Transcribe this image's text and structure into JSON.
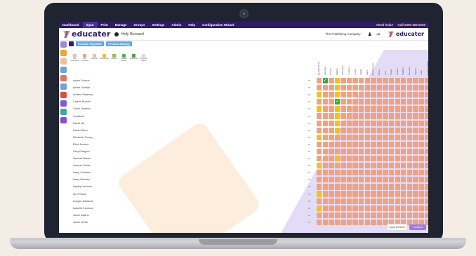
{
  "nav": {
    "items": [
      "Dashboard",
      "Input",
      "Print",
      "Manage",
      "Groups",
      "Settings",
      "Admin",
      "Help",
      "Configuration Wizard"
    ],
    "active_index": 1,
    "need_help": "Need help?",
    "phone": "Call 0300 303 0220"
  },
  "header": {
    "logo_text": "educater",
    "user_name": "Holly Ricouard",
    "org_name": "The Publishing Company",
    "logo2_text": "educater"
  },
  "toolbar": {
    "btn1": "Personal Targets/Ex",
    "btn2": "Personal Strategy"
  },
  "legend": [
    {
      "label": "Not Assessed",
      "color": "#c9c9c9"
    },
    {
      "label": "Not Covered",
      "color": "#f0a27f"
    },
    {
      "label": "Attempt",
      "color": "#f5c089"
    },
    {
      "label": "Developing",
      "color": "#f1c21b"
    },
    {
      "label": "Secure",
      "color": "#8cc63f"
    },
    {
      "label": "Greater Depth",
      "color": "#52b05a"
    },
    {
      "label": "Mastered",
      "color": "#3da640"
    },
    {
      "label": "Remove Grade",
      "color": "#dddddd"
    }
  ],
  "students": [
    "Aaron Francis",
    "Alexie Smithie",
    "Andrea Sharman",
    "Callum Burnell",
    "Chloe Jackson",
    "Coralblue",
    "David Hill",
    "Daniel Steer",
    "Elizabeth Finney",
    "Elliot Jenkins",
    "Gary Rodgers",
    "Hannah Bristol",
    "Hannah Carter",
    "Harry Cookson",
    "Harry Machen",
    "Hayley Johnson",
    "Ian Preston",
    "Imogen Edwards",
    "Isabella Cookson",
    "Jamie Adkins",
    "Jamie Webb"
  ],
  "scores": [
    "66",
    "66",
    "66",
    "66",
    "66",
    "66",
    "66",
    "66",
    "66",
    "66",
    "66",
    "66",
    "66",
    "66",
    "66",
    "66",
    "66",
    "66",
    "66",
    "66",
    "66"
  ],
  "columns": [
    "Reading Words",
    "Counting",
    "Number",
    "Addition",
    "Subtraction",
    "Fractions",
    "Length",
    "Weight",
    "Mass",
    "Measurement",
    "Money",
    "Time",
    "Shape",
    "Position",
    "Statistics",
    "Geometry",
    "Algebra",
    "Ratio",
    "Problem Solving"
  ],
  "grid": [
    [
      "o",
      "g",
      "o",
      "y",
      "o",
      "o",
      "o",
      "o",
      "o",
      "o",
      "o",
      "o",
      "o",
      "o",
      "o",
      "o",
      "o",
      "o",
      "o"
    ],
    [
      "o",
      "o",
      "o",
      "y",
      "o",
      "o",
      "o",
      "o",
      "o",
      "o",
      "o",
      "o",
      "o",
      "o",
      "o",
      "o",
      "o",
      "o",
      "o"
    ],
    [
      "y",
      "o",
      "o",
      "y",
      "o",
      "o",
      "o",
      "o",
      "o",
      "o",
      "o",
      "o",
      "o",
      "o",
      "o",
      "o",
      "o",
      "o",
      "o"
    ],
    [
      "o",
      "o",
      "o",
      "g",
      "o",
      "o",
      "o",
      "o",
      "o",
      "o",
      "o",
      "o",
      "o",
      "o",
      "o",
      "o",
      "o",
      "o",
      "o"
    ],
    [
      "y",
      "o",
      "o",
      "y",
      "o",
      "o",
      "o",
      "o",
      "o",
      "o",
      "o",
      "o",
      "o",
      "o",
      "o",
      "o",
      "o",
      "o",
      "o"
    ],
    [
      "o",
      "o",
      "o",
      "y",
      "o",
      "o",
      "o",
      "o",
      "o",
      "o",
      "o",
      "o",
      "o",
      "o",
      "o",
      "o",
      "o",
      "o",
      "o"
    ],
    [
      "o",
      "o",
      "o",
      "y",
      "o",
      "o",
      "o",
      "o",
      "o",
      "o",
      "o",
      "o",
      "o",
      "o",
      "o",
      "o",
      "o",
      "o",
      "o"
    ],
    [
      "o",
      "o",
      "o",
      "y",
      "o",
      "o",
      "o",
      "o",
      "o",
      "o",
      "o",
      "o",
      "o",
      "o",
      "o",
      "o",
      "o",
      "o",
      "o"
    ],
    [
      "y",
      "o",
      "o",
      "o",
      "o",
      "o",
      "o",
      "o",
      "o",
      "o",
      "o",
      "o",
      "o",
      "o",
      "o",
      "o",
      "o",
      "o",
      "o"
    ],
    [
      "o",
      "o",
      "o",
      "o",
      "o",
      "o",
      "o",
      "o",
      "o",
      "o",
      "o",
      "o",
      "o",
      "o",
      "o",
      "o",
      "o",
      "o",
      "o"
    ],
    [
      "o",
      "o",
      "o",
      "o",
      "o",
      "o",
      "o",
      "o",
      "o",
      "o",
      "o",
      "o",
      "o",
      "o",
      "o",
      "o",
      "o",
      "o",
      "o"
    ],
    [
      "o",
      "o",
      "o",
      "y",
      "o",
      "o",
      "o",
      "o",
      "o",
      "o",
      "o",
      "o",
      "o",
      "o",
      "o",
      "o",
      "o",
      "o",
      "o"
    ],
    [
      "y",
      "o",
      "o",
      "o",
      "o",
      "o",
      "o",
      "o",
      "o",
      "o",
      "o",
      "o",
      "o",
      "o",
      "o",
      "o",
      "o",
      "o",
      "o"
    ],
    [
      "o",
      "o",
      "o",
      "o",
      "o",
      "o",
      "o",
      "o",
      "o",
      "o",
      "o",
      "o",
      "o",
      "o",
      "o",
      "o",
      "o",
      "o",
      "o"
    ],
    [
      "o",
      "o",
      "o",
      "o",
      "o",
      "o",
      "o",
      "o",
      "o",
      "o",
      "o",
      "o",
      "o",
      "o",
      "o",
      "o",
      "o",
      "o",
      "o"
    ],
    [
      "o",
      "o",
      "o",
      "o",
      "o",
      "o",
      "o",
      "o",
      "o",
      "o",
      "o",
      "o",
      "o",
      "o",
      "o",
      "o",
      "o",
      "o",
      "o"
    ],
    [
      "y",
      "o",
      "o",
      "o",
      "o",
      "o",
      "o",
      "o",
      "o",
      "o",
      "o",
      "o",
      "o",
      "o",
      "o",
      "o",
      "o",
      "o",
      "o"
    ],
    [
      "o",
      "o",
      "o",
      "o",
      "o",
      "o",
      "o",
      "o",
      "o",
      "o",
      "o",
      "o",
      "o",
      "o",
      "o",
      "o",
      "o",
      "o",
      "o"
    ],
    [
      "y",
      "o",
      "o",
      "o",
      "o",
      "o",
      "o",
      "o",
      "o",
      "o",
      "o",
      "o",
      "o",
      "o",
      "o",
      "o",
      "o",
      "o",
      "o"
    ],
    [
      "o",
      "o",
      "o",
      "o",
      "o",
      "o",
      "o",
      "o",
      "o",
      "o",
      "o",
      "o",
      "o",
      "o",
      "o",
      "o",
      "o",
      "o",
      "o"
    ],
    [
      "o",
      "o",
      "o",
      "o",
      "o",
      "o",
      "o",
      "o",
      "o",
      "o",
      "o",
      "o",
      "o",
      "o",
      "o",
      "o",
      "o",
      "o",
      "o"
    ]
  ],
  "footer": {
    "secondary": "Apply Defaults",
    "primary": "Continue"
  },
  "colors": {
    "nav_bg": "#2f1b6b",
    "accent_purple": "#9a7ae6",
    "cell_not_covered": "#f0a27f",
    "cell_developing": "#f1c21b",
    "cell_mastered": "#3da640"
  }
}
